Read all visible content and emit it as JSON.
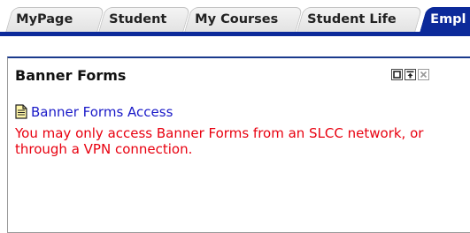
{
  "tabs": [
    {
      "label": "MyPage"
    },
    {
      "label": "Student"
    },
    {
      "label": "My Courses"
    },
    {
      "label": "Student Life"
    },
    {
      "label": "Empl"
    }
  ],
  "colors": {
    "active_tab": "#0c2a9a",
    "link": "#1a1ac8",
    "warning": "#e8000f"
  },
  "portlet": {
    "title": "Banner Forms",
    "link_label": "Banner Forms Access",
    "link_icon": "document-icon",
    "notice": "You may only access Banner Forms from an SLCC network, or through a VPN connection.",
    "controls": [
      "restore-icon",
      "maximize-icon",
      "close-icon"
    ]
  }
}
